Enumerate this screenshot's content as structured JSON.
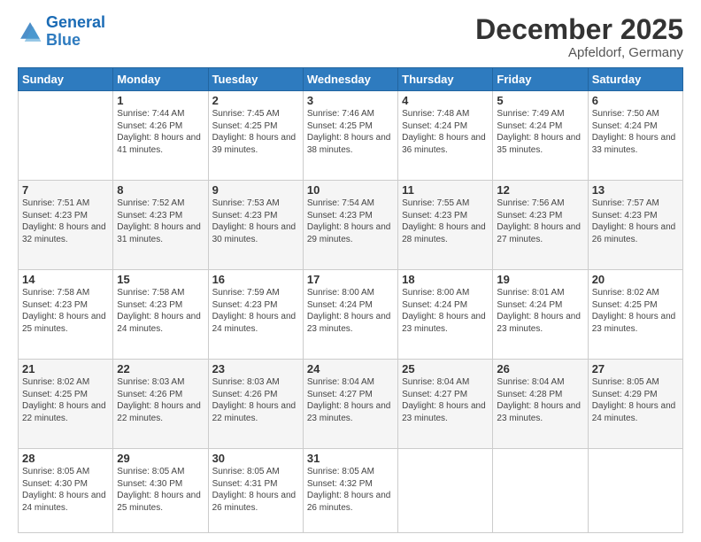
{
  "header": {
    "logo_general": "General",
    "logo_blue": "Blue",
    "month": "December 2025",
    "location": "Apfeldorf, Germany"
  },
  "weekdays": [
    "Sunday",
    "Monday",
    "Tuesday",
    "Wednesday",
    "Thursday",
    "Friday",
    "Saturday"
  ],
  "rows": [
    [
      {
        "day": "",
        "sunrise": "",
        "sunset": "",
        "daylight": ""
      },
      {
        "day": "1",
        "sunrise": "Sunrise: 7:44 AM",
        "sunset": "Sunset: 4:26 PM",
        "daylight": "Daylight: 8 hours and 41 minutes."
      },
      {
        "day": "2",
        "sunrise": "Sunrise: 7:45 AM",
        "sunset": "Sunset: 4:25 PM",
        "daylight": "Daylight: 8 hours and 39 minutes."
      },
      {
        "day": "3",
        "sunrise": "Sunrise: 7:46 AM",
        "sunset": "Sunset: 4:25 PM",
        "daylight": "Daylight: 8 hours and 38 minutes."
      },
      {
        "day": "4",
        "sunrise": "Sunrise: 7:48 AM",
        "sunset": "Sunset: 4:24 PM",
        "daylight": "Daylight: 8 hours and 36 minutes."
      },
      {
        "day": "5",
        "sunrise": "Sunrise: 7:49 AM",
        "sunset": "Sunset: 4:24 PM",
        "daylight": "Daylight: 8 hours and 35 minutes."
      },
      {
        "day": "6",
        "sunrise": "Sunrise: 7:50 AM",
        "sunset": "Sunset: 4:24 PM",
        "daylight": "Daylight: 8 hours and 33 minutes."
      }
    ],
    [
      {
        "day": "7",
        "sunrise": "Sunrise: 7:51 AM",
        "sunset": "Sunset: 4:23 PM",
        "daylight": "Daylight: 8 hours and 32 minutes."
      },
      {
        "day": "8",
        "sunrise": "Sunrise: 7:52 AM",
        "sunset": "Sunset: 4:23 PM",
        "daylight": "Daylight: 8 hours and 31 minutes."
      },
      {
        "day": "9",
        "sunrise": "Sunrise: 7:53 AM",
        "sunset": "Sunset: 4:23 PM",
        "daylight": "Daylight: 8 hours and 30 minutes."
      },
      {
        "day": "10",
        "sunrise": "Sunrise: 7:54 AM",
        "sunset": "Sunset: 4:23 PM",
        "daylight": "Daylight: 8 hours and 29 minutes."
      },
      {
        "day": "11",
        "sunrise": "Sunrise: 7:55 AM",
        "sunset": "Sunset: 4:23 PM",
        "daylight": "Daylight: 8 hours and 28 minutes."
      },
      {
        "day": "12",
        "sunrise": "Sunrise: 7:56 AM",
        "sunset": "Sunset: 4:23 PM",
        "daylight": "Daylight: 8 hours and 27 minutes."
      },
      {
        "day": "13",
        "sunrise": "Sunrise: 7:57 AM",
        "sunset": "Sunset: 4:23 PM",
        "daylight": "Daylight: 8 hours and 26 minutes."
      }
    ],
    [
      {
        "day": "14",
        "sunrise": "Sunrise: 7:58 AM",
        "sunset": "Sunset: 4:23 PM",
        "daylight": "Daylight: 8 hours and 25 minutes."
      },
      {
        "day": "15",
        "sunrise": "Sunrise: 7:58 AM",
        "sunset": "Sunset: 4:23 PM",
        "daylight": "Daylight: 8 hours and 24 minutes."
      },
      {
        "day": "16",
        "sunrise": "Sunrise: 7:59 AM",
        "sunset": "Sunset: 4:23 PM",
        "daylight": "Daylight: 8 hours and 24 minutes."
      },
      {
        "day": "17",
        "sunrise": "Sunrise: 8:00 AM",
        "sunset": "Sunset: 4:24 PM",
        "daylight": "Daylight: 8 hours and 23 minutes."
      },
      {
        "day": "18",
        "sunrise": "Sunrise: 8:00 AM",
        "sunset": "Sunset: 4:24 PM",
        "daylight": "Daylight: 8 hours and 23 minutes."
      },
      {
        "day": "19",
        "sunrise": "Sunrise: 8:01 AM",
        "sunset": "Sunset: 4:24 PM",
        "daylight": "Daylight: 8 hours and 23 minutes."
      },
      {
        "day": "20",
        "sunrise": "Sunrise: 8:02 AM",
        "sunset": "Sunset: 4:25 PM",
        "daylight": "Daylight: 8 hours and 23 minutes."
      }
    ],
    [
      {
        "day": "21",
        "sunrise": "Sunrise: 8:02 AM",
        "sunset": "Sunset: 4:25 PM",
        "daylight": "Daylight: 8 hours and 22 minutes."
      },
      {
        "day": "22",
        "sunrise": "Sunrise: 8:03 AM",
        "sunset": "Sunset: 4:26 PM",
        "daylight": "Daylight: 8 hours and 22 minutes."
      },
      {
        "day": "23",
        "sunrise": "Sunrise: 8:03 AM",
        "sunset": "Sunset: 4:26 PM",
        "daylight": "Daylight: 8 hours and 22 minutes."
      },
      {
        "day": "24",
        "sunrise": "Sunrise: 8:04 AM",
        "sunset": "Sunset: 4:27 PM",
        "daylight": "Daylight: 8 hours and 23 minutes."
      },
      {
        "day": "25",
        "sunrise": "Sunrise: 8:04 AM",
        "sunset": "Sunset: 4:27 PM",
        "daylight": "Daylight: 8 hours and 23 minutes."
      },
      {
        "day": "26",
        "sunrise": "Sunrise: 8:04 AM",
        "sunset": "Sunset: 4:28 PM",
        "daylight": "Daylight: 8 hours and 23 minutes."
      },
      {
        "day": "27",
        "sunrise": "Sunrise: 8:05 AM",
        "sunset": "Sunset: 4:29 PM",
        "daylight": "Daylight: 8 hours and 24 minutes."
      }
    ],
    [
      {
        "day": "28",
        "sunrise": "Sunrise: 8:05 AM",
        "sunset": "Sunset: 4:30 PM",
        "daylight": "Daylight: 8 hours and 24 minutes."
      },
      {
        "day": "29",
        "sunrise": "Sunrise: 8:05 AM",
        "sunset": "Sunset: 4:30 PM",
        "daylight": "Daylight: 8 hours and 25 minutes."
      },
      {
        "day": "30",
        "sunrise": "Sunrise: 8:05 AM",
        "sunset": "Sunset: 4:31 PM",
        "daylight": "Daylight: 8 hours and 26 minutes."
      },
      {
        "day": "31",
        "sunrise": "Sunrise: 8:05 AM",
        "sunset": "Sunset: 4:32 PM",
        "daylight": "Daylight: 8 hours and 26 minutes."
      },
      {
        "day": "",
        "sunrise": "",
        "sunset": "",
        "daylight": ""
      },
      {
        "day": "",
        "sunrise": "",
        "sunset": "",
        "daylight": ""
      },
      {
        "day": "",
        "sunrise": "",
        "sunset": "",
        "daylight": ""
      }
    ]
  ]
}
